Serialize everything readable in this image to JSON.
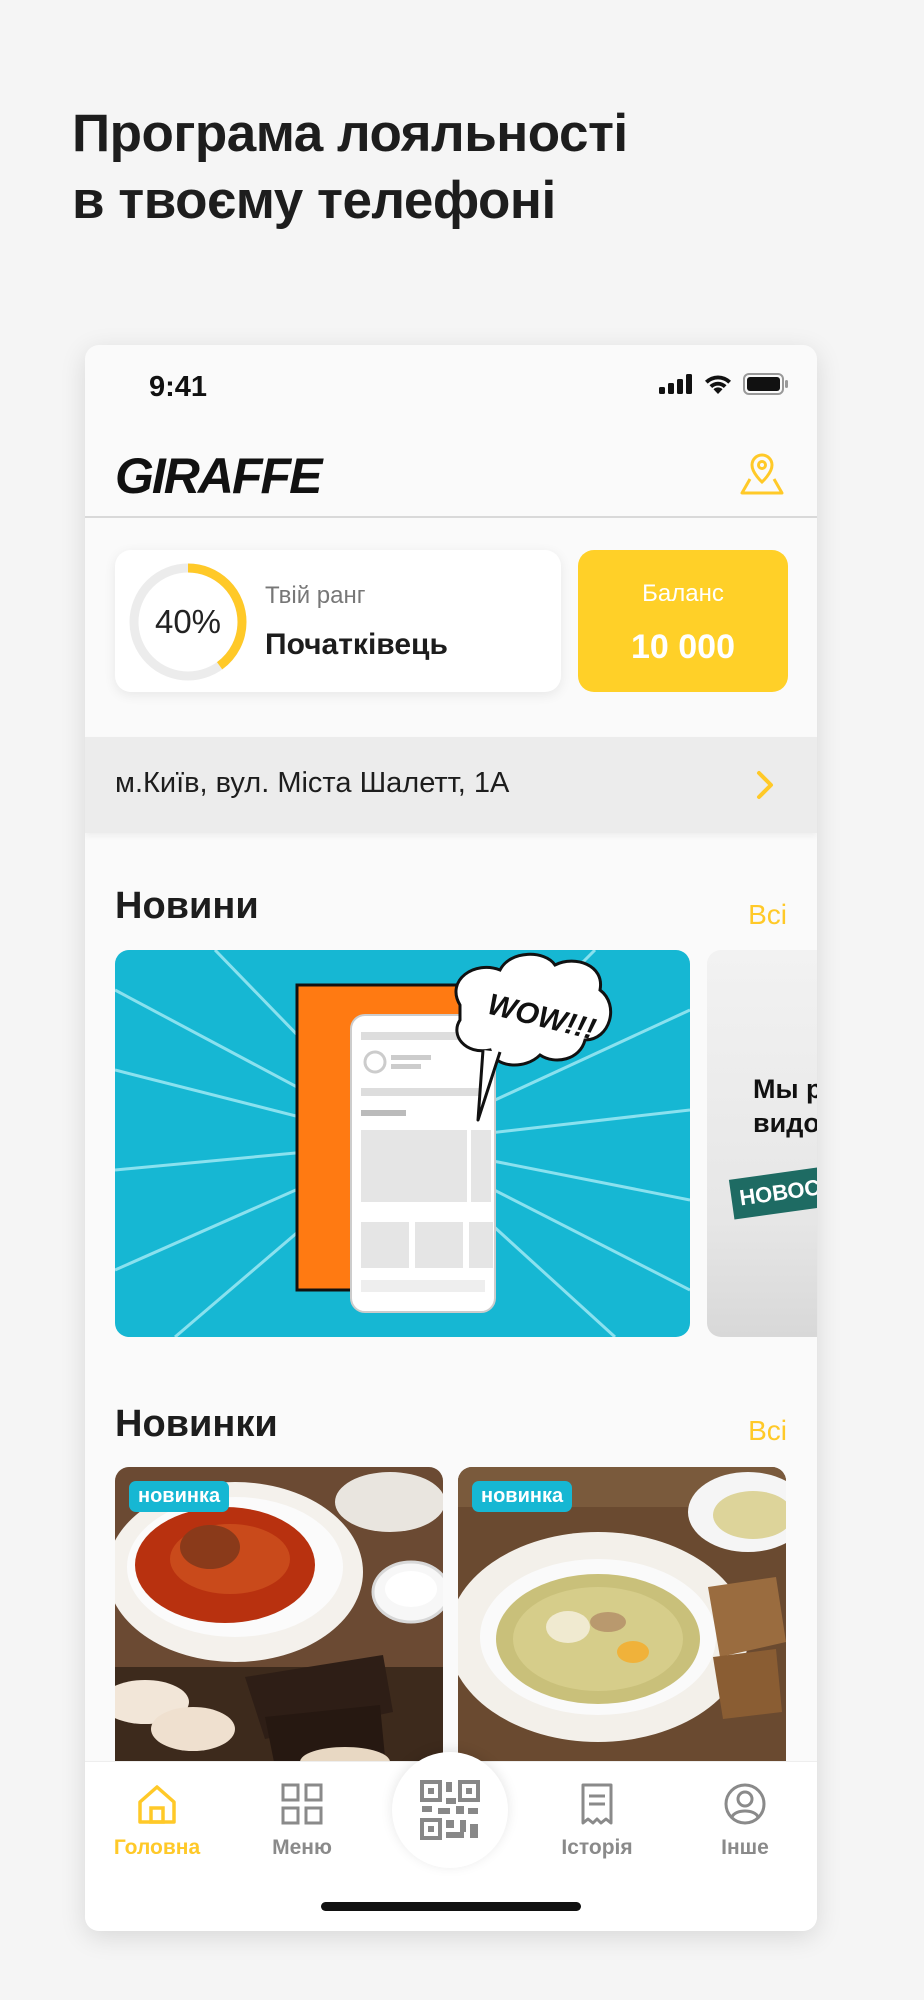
{
  "headline": {
    "line1": "Програма лояльності",
    "line2": "в твоєму телефоні"
  },
  "status_bar": {
    "time": "9:41"
  },
  "header": {
    "logo_text": "GIRAFFE",
    "map_icon": "map-pin-icon"
  },
  "rank": {
    "percent_label": "40%",
    "progress": 0.4,
    "label": "Твій ранг",
    "value": "Початківець"
  },
  "balance": {
    "label": "Баланс",
    "value": "10 000"
  },
  "address": {
    "text": "м.Київ, вул. Міста Шалетт, 1А"
  },
  "news": {
    "title": "Новини",
    "all_label": "Всі",
    "main_card": {
      "bubble_text": "WOW!!!"
    },
    "side_card": {
      "line1": "Мы р",
      "line2": "видо",
      "banner": "НОВОС"
    }
  },
  "new_items": {
    "title": "Новинки",
    "all_label": "Всі",
    "items": [
      {
        "badge": "новинка"
      },
      {
        "badge": "новинка"
      }
    ]
  },
  "tabs": [
    {
      "label": "Головна",
      "icon": "home-icon",
      "active": true
    },
    {
      "label": "Меню",
      "icon": "grid-icon",
      "active": false
    },
    {
      "label": "",
      "icon": "qr-code-icon",
      "active": false
    },
    {
      "label": "Історія",
      "icon": "receipt-icon",
      "active": false
    },
    {
      "label": "Інше",
      "icon": "user-icon",
      "active": false
    }
  ],
  "colors": {
    "accent": "#ffd028",
    "accent_text": "#ffc928",
    "cyan": "#16b7d3",
    "orange": "#ff7a12"
  }
}
